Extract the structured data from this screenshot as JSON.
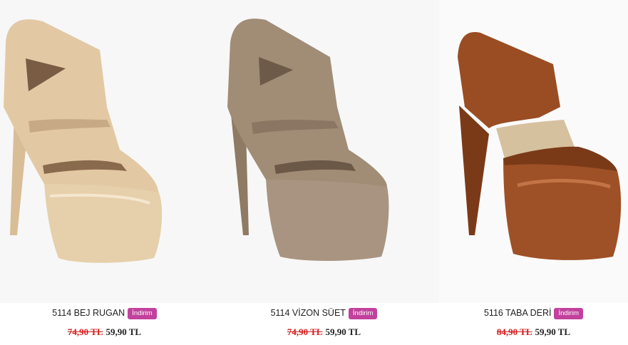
{
  "products": [
    {
      "name": "5114 BEJ RUGAN",
      "badge": "İndirim",
      "old_price": "74,90 TL",
      "new_price": "59,90 TL",
      "color": "#e2c9a4"
    },
    {
      "name": "5114 VİZON SÜET",
      "badge": "İndirim",
      "old_price": "74,90 TL",
      "new_price": "59,90 TL",
      "color": "#a18c76"
    },
    {
      "name": "5116 TABA DERİ",
      "badge": "İndirim",
      "old_price": "84,90 TL",
      "new_price": "59,90 TL",
      "color": "#9a4d22"
    }
  ],
  "colors": {
    "badge": "#c2419d",
    "old_price": "#d42020"
  }
}
